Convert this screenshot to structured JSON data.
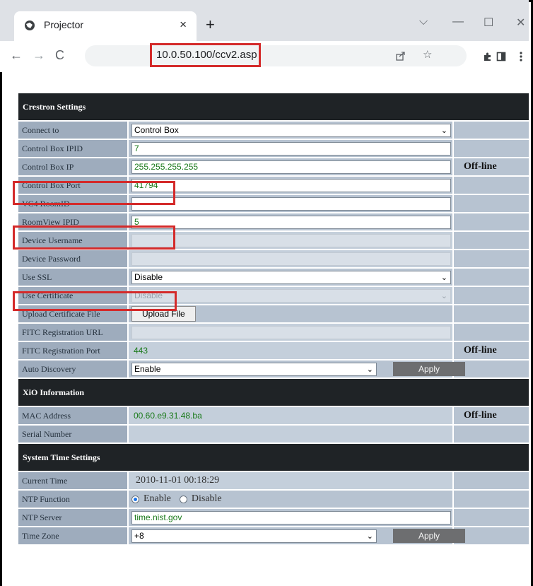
{
  "browser": {
    "tab_title": "Projector",
    "tab_close": "×",
    "new_tab": "+",
    "url": "10.0.50.100/ccv2.asp",
    "window_controls": {
      "dropdown": "⌵",
      "minimize": "—",
      "maximize": "☐",
      "close": "✕"
    },
    "nav": {
      "back": "←",
      "forward": "→",
      "reload": "C"
    },
    "icons": [
      "share-icon",
      "star-icon",
      "extensions-icon",
      "sidepanel-icon",
      "menu-icon"
    ]
  },
  "highlight_color": "#d42a2a",
  "sections": {
    "crestron": {
      "title": "Crestron Settings",
      "rows": {
        "connect_to": {
          "label": "Connect to",
          "value": "Control Box"
        },
        "control_box_ipid": {
          "label": "Control Box IPID",
          "value": "7"
        },
        "control_box_ip": {
          "label": "Control Box IP",
          "value": "255.255.255.255",
          "status": "Off-line"
        },
        "control_box_port": {
          "label": "Control Box Port",
          "value": "41794"
        },
        "vc4_roomid": {
          "label": "VC4 RoomID",
          "value": ""
        },
        "roomview_ipid": {
          "label": "RoomView IPID",
          "value": "5"
        },
        "device_username": {
          "label": "Device Username",
          "value": ""
        },
        "device_password": {
          "label": "Device Password",
          "value": ""
        },
        "use_ssl": {
          "label": "Use SSL",
          "value": "Disable"
        },
        "use_certificate": {
          "label": "Use Certificate",
          "value": "Disable"
        },
        "upload_certificate": {
          "label": "Upload Certificate File",
          "button": "Upload File"
        },
        "fitc_url": {
          "label": "FITC Registration URL",
          "value": ""
        },
        "fitc_port": {
          "label": "FITC Registration Port",
          "value": "443",
          "status": "Off-line"
        },
        "auto_discovery": {
          "label": "Auto Discovery",
          "value": "Enable",
          "button": "Apply"
        }
      }
    },
    "xio": {
      "title": "XiO Information",
      "rows": {
        "mac": {
          "label": "MAC Address",
          "value": "00.60.e9.31.48.ba",
          "status": "Off-line"
        },
        "serial": {
          "label": "Serial Number",
          "value": ""
        }
      }
    },
    "time": {
      "title": "System Time Settings",
      "rows": {
        "current_time": {
          "label": "Current Time",
          "value": "2010-11-01 00:18:29"
        },
        "ntp_function": {
          "label": "NTP Function",
          "option_enable": "Enable",
          "option_disable": "Disable",
          "selected": "Enable"
        },
        "ntp_server": {
          "label": "NTP Server",
          "value": "time.nist.gov"
        },
        "time_zone": {
          "label": "Time Zone",
          "value": "+8",
          "button": "Apply"
        }
      }
    }
  }
}
